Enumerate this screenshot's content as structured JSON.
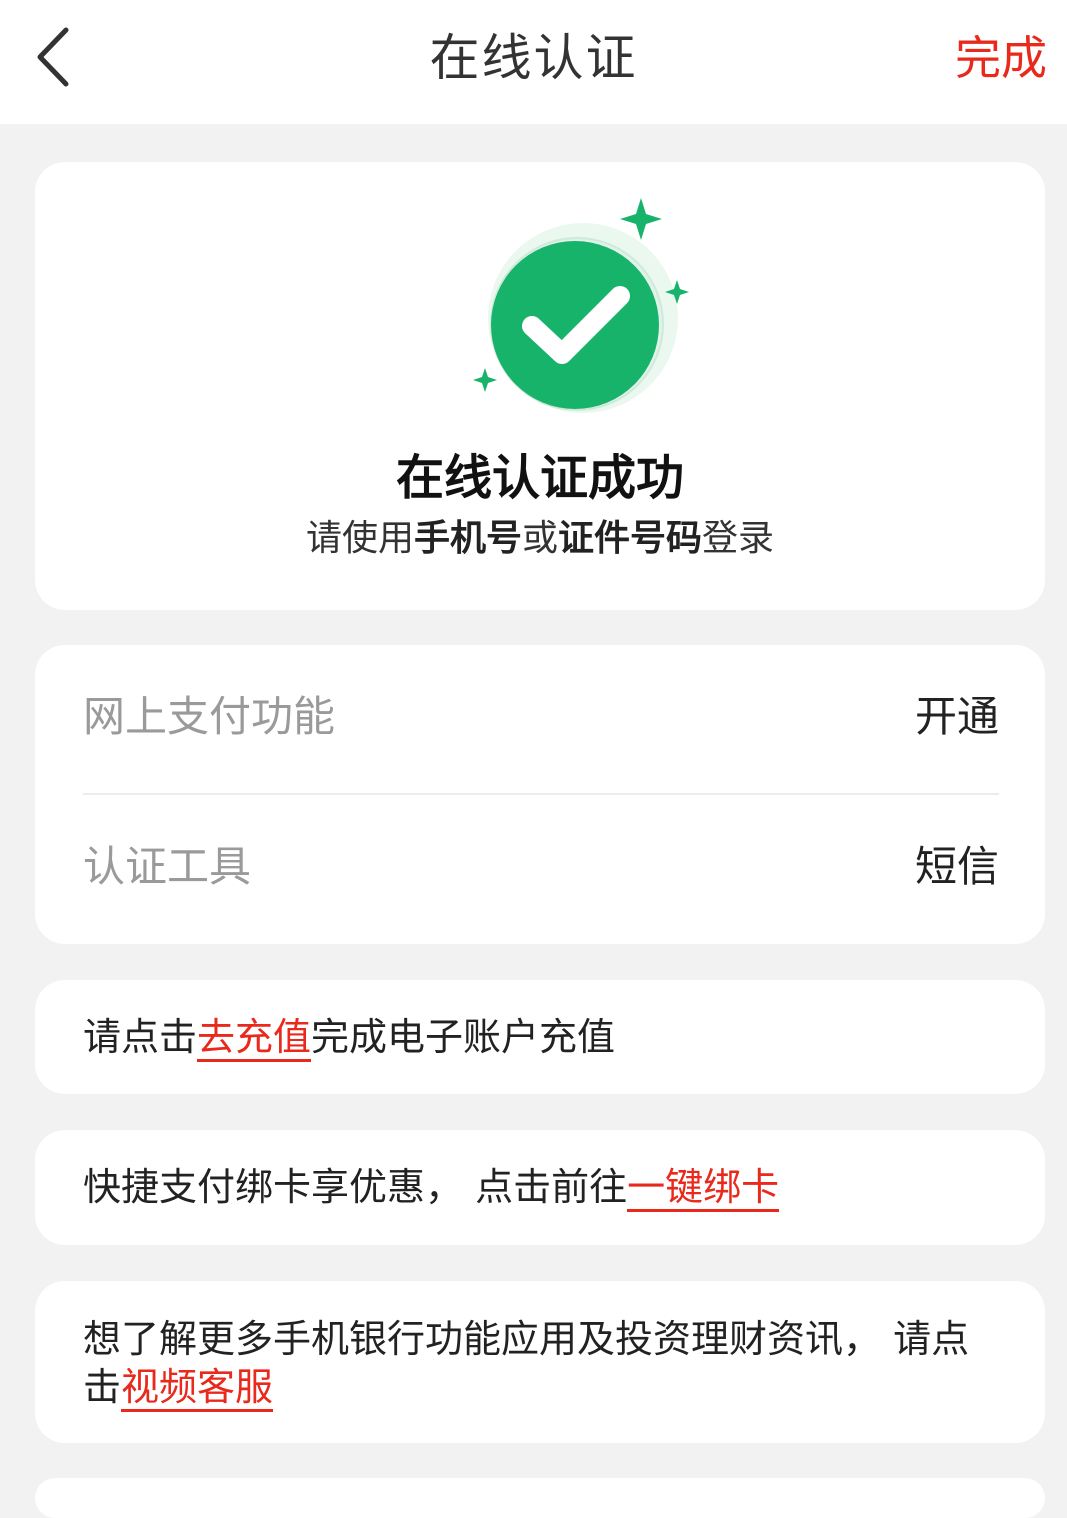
{
  "nav": {
    "title": "在线认证",
    "done_label": "完成"
  },
  "hero": {
    "heading": "在线认证成功",
    "sub_prefix": "请使用",
    "sub_bold1": "手机号",
    "sub_mid": "或",
    "sub_bold2": "证件号码",
    "sub_suffix": "登录",
    "icon": "check-circle-icon",
    "accent": "#17b26a"
  },
  "info": {
    "rows": [
      {
        "label": "网上支付功能",
        "value": "开通"
      },
      {
        "label": "认证工具",
        "value": "短信"
      }
    ]
  },
  "tips": {
    "recharge": {
      "prefix": "请点击",
      "link": "去充值",
      "suffix": "完成电子账户充值"
    },
    "bind": {
      "prefix": "快捷支付绑卡享优惠， 点击前往",
      "link": "一键绑卡"
    },
    "video": {
      "prefix": "想了解更多手机银行功能应用及投资理财资讯， 请点击",
      "link": "视频客服"
    }
  },
  "colors": {
    "link": "#e8291c",
    "background": "#f2f2f2"
  }
}
